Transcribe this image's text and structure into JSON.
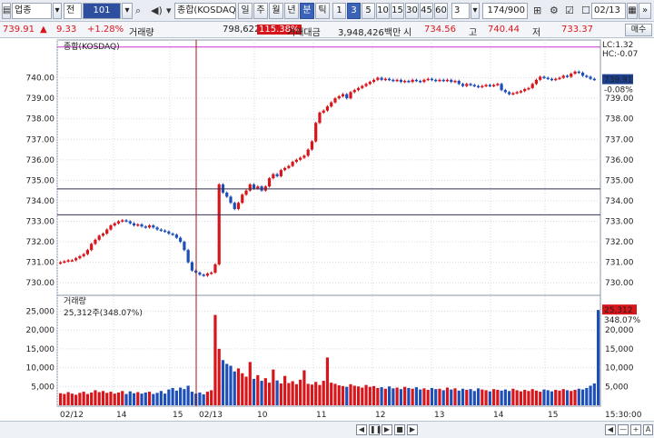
{
  "toolbar": {
    "market": "업종",
    "market_type": "전",
    "code": "101",
    "name": "종합(KOSDAQ)",
    "periods": [
      "일",
      "주",
      "월",
      "년",
      "분",
      "틱"
    ],
    "selected_period": "분",
    "interval_buttons": [
      "1",
      "3",
      "5",
      "10",
      "15",
      "30",
      "45",
      "60"
    ],
    "selected_interval": "3",
    "interval_value": "3",
    "count": "174/900",
    "date": "02/13"
  },
  "quote": {
    "price": "739.91",
    "arrow": "▲",
    "change": "9.33",
    "change_pct": "+1.28%",
    "volume_label": "거래량",
    "volume": "798,622",
    "volume_pct": "115.38%",
    "amount_label": "거래대금",
    "amount": "3,948,426백만",
    "open_label": "시",
    "open": "734.56",
    "high_label": "고",
    "high": "740.44",
    "low_label": "저",
    "low": "733.37",
    "order_button": "매수"
  },
  "chart_data": {
    "type": "candlestick",
    "title": "종합(KOSDAQ)",
    "price_axis": {
      "ticks": [
        "740.00",
        "739.00",
        "738.00",
        "737.00",
        "736.00",
        "735.00",
        "734.00",
        "733.00",
        "732.00",
        "731.00",
        "730.00"
      ],
      "ylim": [
        729.7,
        741.4
      ]
    },
    "volume_axis": {
      "label": "거래량",
      "ticks": [
        "25,000",
        "20,000",
        "15,000",
        "10,000",
        "5,000"
      ],
      "ylim": [
        0,
        28000
      ]
    },
    "x_labels": [
      "02/12",
      "14",
      "15",
      "02/13",
      "10",
      "11",
      "12",
      "13",
      "14",
      "15"
    ],
    "hlines": [
      741.5,
      734.58,
      733.32
    ],
    "price_labels": {
      "lc": "LC:1.32",
      "hc": "HC:-0.07",
      "current": "739.91",
      "current_pct": "-0.08%"
    },
    "volume_labels": {
      "current": "25,312주(348.07%)",
      "current_badge": "25,312",
      "current_pct": "348.07%"
    },
    "right_time": "15:30:00",
    "closes": [
      731.0,
      731.05,
      731.1,
      731.1,
      731.2,
      731.3,
      731.4,
      731.6,
      731.9,
      732.1,
      732.3,
      732.4,
      732.6,
      732.8,
      732.9,
      733.0,
      733.05,
      733.0,
      732.9,
      732.8,
      732.85,
      732.75,
      732.7,
      732.8,
      732.7,
      732.6,
      732.55,
      732.5,
      732.4,
      732.35,
      732.2,
      732.0,
      731.6,
      731.0,
      730.6,
      730.5,
      730.4,
      730.35,
      730.45,
      730.5,
      730.9,
      734.8,
      734.4,
      734.2,
      733.9,
      733.6,
      733.9,
      734.3,
      734.5,
      734.8,
      734.6,
      734.7,
      734.5,
      734.7,
      735.1,
      735.3,
      735.2,
      735.5,
      735.6,
      735.7,
      735.9,
      736.0,
      736.1,
      736.2,
      736.5,
      736.9,
      737.8,
      738.3,
      738.4,
      738.6,
      738.8,
      739.0,
      739.1,
      739.2,
      739.0,
      739.3,
      739.4,
      739.5,
      739.6,
      739.7,
      739.8,
      739.9,
      740.0,
      739.9,
      739.95,
      739.9,
      739.85,
      739.9,
      739.8,
      739.85,
      739.8,
      739.9,
      739.85,
      739.8,
      739.9,
      739.95,
      739.9,
      739.85,
      739.9,
      739.85,
      739.9,
      739.8,
      739.85,
      739.7,
      739.6,
      739.7,
      739.65,
      739.6,
      739.55,
      739.6,
      739.65,
      739.6,
      739.65,
      739.7,
      739.4,
      739.3,
      739.2,
      739.25,
      739.3,
      739.35,
      739.45,
      739.5,
      739.7,
      739.9,
      740.05,
      740.0,
      739.95,
      739.9,
      739.95,
      740.0,
      740.1,
      740.05,
      740.2,
      740.3,
      740.25,
      740.1,
      740.05,
      739.95,
      739.91
    ],
    "volumes": [
      3200,
      3000,
      3500,
      3100,
      2800,
      3300,
      3600,
      3000,
      3400,
      4000,
      3500,
      3800,
      3300,
      3600,
      3100,
      3400,
      3800,
      3000,
      3700,
      3200,
      3500,
      3100,
      3400,
      3600,
      3000,
      3300,
      3800,
      3100,
      4200,
      4600,
      3900,
      4700,
      4300,
      5200,
      3600,
      3100,
      3400,
      2900,
      3600,
      4000,
      24000,
      15000,
      12000,
      11000,
      10500,
      9000,
      9800,
      8500,
      7600,
      11500,
      7000,
      8000,
      6500,
      7200,
      6000,
      9500,
      6600,
      5800,
      7800,
      5900,
      6400,
      5600,
      6800,
      9300,
      5700,
      5500,
      6200,
      5400,
      6500,
      12700,
      6000,
      5700,
      5300,
      5100,
      4900,
      5600,
      5200,
      5000,
      4700,
      5400,
      4900,
      5100,
      4600,
      4800,
      4400,
      5000,
      4500,
      4700,
      4300,
      4900,
      4600,
      4400,
      4800,
      4200,
      4500,
      4100,
      4600,
      4300,
      4400,
      4000,
      4700,
      4200,
      4500,
      3900,
      4400,
      4100,
      4300,
      3800,
      4500,
      4200,
      4000,
      3700,
      4300,
      4100,
      3900,
      4200,
      3800,
      4400,
      4000,
      3700,
      4100,
      3800,
      4300,
      3900,
      3600,
      4200,
      4000,
      3700,
      4100,
      3900,
      4300,
      4000,
      3800,
      4100,
      4400,
      4200,
      4600,
      5200,
      5800,
      25312
    ]
  },
  "icons": {
    "search": "search-icon",
    "settings": "gear-icon",
    "check": "checkbox-icon",
    "grid": "grid-icon",
    "nav": "nav-arrow-icon"
  },
  "colors": {
    "up": "#d8151b",
    "down": "#1d4fb8",
    "grid": "#d6dbe3",
    "hline_top": "#cc33cc",
    "hline": "#333355",
    "vline": "#a01818"
  }
}
